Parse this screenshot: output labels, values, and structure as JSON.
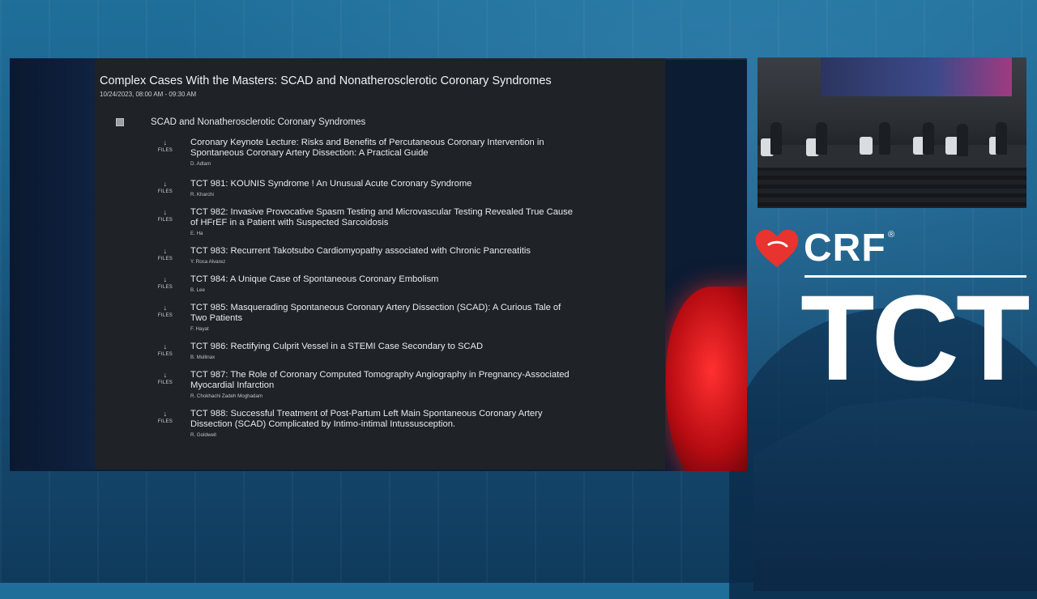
{
  "session": {
    "title": "Complex Cases With the Masters: SCAD and Nonatherosclerotic Coronary Syndromes",
    "datetime": "10/24/2023, 08:00 AM - 09:30 AM"
  },
  "section": {
    "title": "SCAD and Nonatherosclerotic Coronary Syndromes"
  },
  "files_label": "FILES",
  "files_arrow": "↓",
  "items": [
    {
      "title": "Coronary Keynote Lecture: Risks and Benefits of Percutaneous Coronary Intervention in Spontaneous Coronary Artery Dissection: A Practical Guide",
      "author": "D. Adlam"
    },
    {
      "title": "TCT 981: KOUNIS Syndrome ! An Unusual Acute Coronary Syndrome",
      "author": "R. Kharchi"
    },
    {
      "title": "TCT 982: Invasive Provocative Spasm Testing and Microvascular Testing Revealed True Cause of HFrEF in a Patient with Suspected Sarcoidosis",
      "author": "E. Ha"
    },
    {
      "title": "TCT 983: Recurrent Takotsubo Cardiomyopathy associated with Chronic Pancreatitis",
      "author": "Y. Roca Alvarez"
    },
    {
      "title": "TCT 984: A Unique Case of Spontaneous Coronary Embolism",
      "author": "B. Lee"
    },
    {
      "title": "TCT 985: Masquerading Spontaneous Coronary Artery Dissection (SCAD): A Curious Tale of Two Patients",
      "author": "F. Hayat"
    },
    {
      "title": "TCT 986: Rectifying Culprit Vessel in a STEMI Case Secondary to SCAD",
      "author": "B. Mullinax"
    },
    {
      "title": "TCT 987: The Role of Coronary Computed Tomography Angiography in Pregnancy-Associated Myocardial Infarction",
      "author": "R. Chokhachi Zadeh Moghadam"
    },
    {
      "title": "TCT 988: Successful Treatment of Post-Partum Left Main Spontaneous Coronary Artery Dissection (SCAD) Complicated by Intimo-intimal Intussusception.",
      "author": "R. Goldweit"
    }
  ],
  "branding": {
    "crf": "CRF",
    "registered": "®",
    "tct": "TCT",
    "heart_color": "#e8332f"
  }
}
